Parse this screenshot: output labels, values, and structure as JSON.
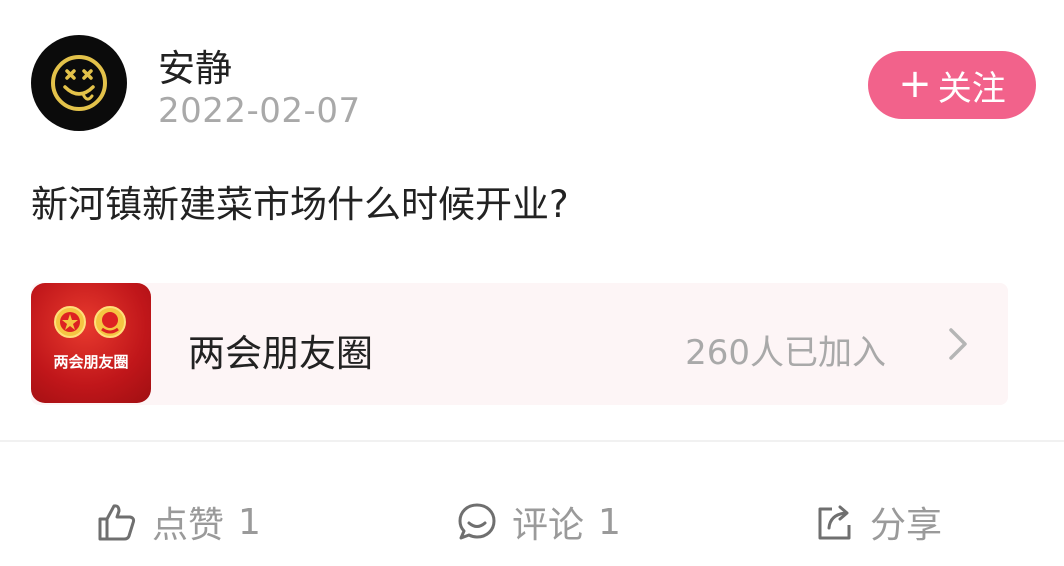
{
  "author": {
    "name": "安静",
    "date": "2022-02-07",
    "avatar_icon": "smiley-face-icon"
  },
  "follow_button": {
    "label": "关注",
    "plus": "+"
  },
  "post": {
    "text": "新河镇新建菜市场什么时候开业?"
  },
  "circle": {
    "thumbnail_label": "两会朋友圈",
    "name": "两会朋友圈",
    "members": "260人已加入"
  },
  "actions": {
    "like_label": "点赞",
    "like_count": "1",
    "comment_label": "评论",
    "comment_count": "1",
    "share_label": "分享"
  },
  "colors": {
    "follow_bg": "#f2628b",
    "avatar_bg": "#0b0b0b",
    "smiley": "#e3c24a",
    "thumb_red": "#c0161a",
    "muted_text": "#a9a9a9",
    "card_bg": "#fdf5f6"
  }
}
